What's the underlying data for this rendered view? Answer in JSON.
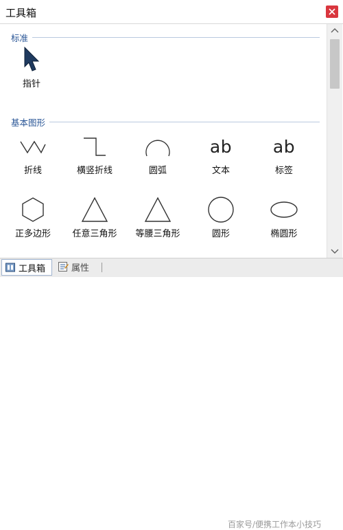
{
  "window": {
    "title": "工具箱"
  },
  "sections": [
    {
      "title": "标准",
      "items": [
        {
          "label": "指针",
          "icon": "pointer-arrow-icon"
        }
      ]
    },
    {
      "title": "基本图形",
      "items": [
        {
          "label": "折线",
          "icon": "polyline-icon"
        },
        {
          "label": "横竖折线",
          "icon": "orthogonal-polyline-icon"
        },
        {
          "label": "圆弧",
          "icon": "arc-icon"
        },
        {
          "label": "文本",
          "icon": "text-icon",
          "glyph": "ab"
        },
        {
          "label": "标签",
          "icon": "label-icon",
          "glyph": "ab"
        },
        {
          "label": "正多边形",
          "icon": "hexagon-icon"
        },
        {
          "label": "任意三角形",
          "icon": "triangle-icon"
        },
        {
          "label": "等腰三角形",
          "icon": "isosceles-triangle-icon"
        },
        {
          "label": "圆形",
          "icon": "circle-icon"
        },
        {
          "label": "椭圆形",
          "icon": "ellipse-icon"
        }
      ]
    }
  ],
  "tabs": [
    {
      "label": "工具箱",
      "active": true,
      "icon": "toolbox-icon"
    },
    {
      "label": "属性",
      "active": false,
      "icon": "properties-icon"
    }
  ],
  "watermark": "百家号/便携工作本小技巧",
  "colors": {
    "section_title": "#2b5797",
    "close_button": "#d9363e",
    "pointer": "#1f3a5f"
  }
}
